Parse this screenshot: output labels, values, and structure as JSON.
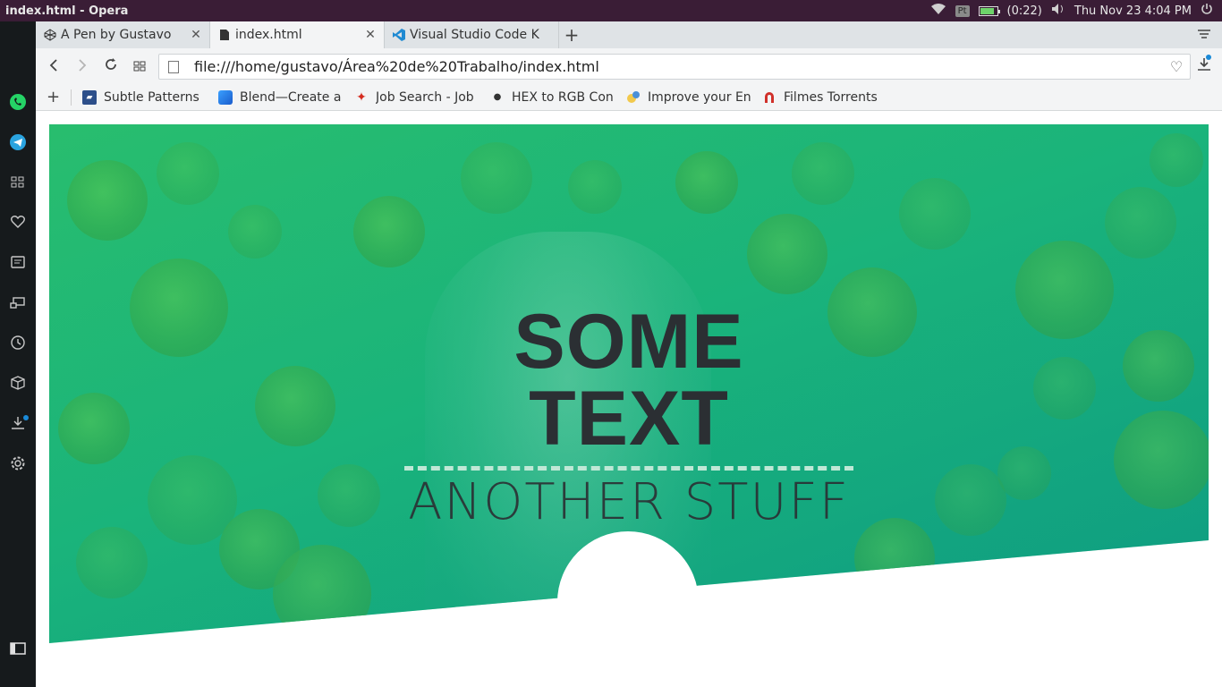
{
  "system": {
    "window_title": "index.html - Opera",
    "battery_text": "(0:22)",
    "datetime": "Thu Nov 23  4:04 PM",
    "lang": "Pt"
  },
  "tabs": [
    {
      "label": "A Pen by Gustavo",
      "icon": "codepen-icon",
      "active": false
    },
    {
      "label": "index.html",
      "icon": "file-icon",
      "active": true
    },
    {
      "label": "Visual Studio Code K",
      "icon": "vscode-icon",
      "active": false
    }
  ],
  "address": {
    "url": "file:///home/gustavo/Área%20de%20Trabalho/index.html"
  },
  "bookmarks": [
    {
      "label": "Subtle Patterns",
      "icon": "subtle-patterns-icon"
    },
    {
      "label": "Blend—Create a",
      "icon": "blend-icon"
    },
    {
      "label": "Job Search - Job",
      "icon": "maple-leaf-icon"
    },
    {
      "label": "HEX to RGB Con",
      "icon": "dot-icon"
    },
    {
      "label": "Improve your En",
      "icon": "improve-icon"
    },
    {
      "label": "Filmes Torrents",
      "icon": "magnet-icon"
    }
  ],
  "hero": {
    "title": "SOME TEXT",
    "subtitle": "ANOTHER STUFF"
  },
  "colors": {
    "hero_gradient_start": "#2cbd6e",
    "hero_gradient_end": "#0f9e83",
    "title_color": "#2b2f33",
    "divider_color": "#bfe8d6",
    "system_bar": "#3a1d36",
    "sidebar": "#161a1c"
  }
}
